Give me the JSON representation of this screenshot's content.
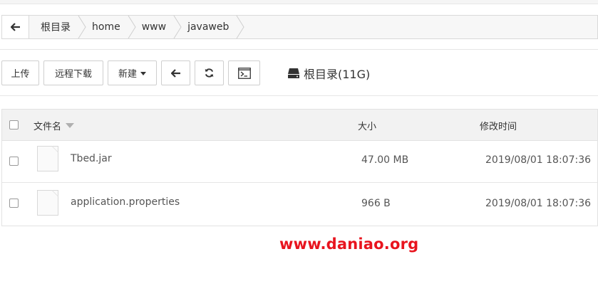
{
  "breadcrumb": {
    "items": [
      "根目录",
      "home",
      "www",
      "javaweb"
    ]
  },
  "toolbar": {
    "upload": "上传",
    "remote_download": "远程下载",
    "new": "新建",
    "disk_label": "根目录(11G)"
  },
  "table": {
    "headers": {
      "name": "文件名",
      "size": "大小",
      "modified": "修改时间"
    },
    "rows": [
      {
        "name": "Tbed.jar",
        "size": "47.00 MB",
        "modified": "2019/08/01 18:07:36"
      },
      {
        "name": "application.properties",
        "size": "966 B",
        "modified": "2019/08/01 18:07:36"
      }
    ]
  },
  "watermark": "www.daniao.org",
  "colors": {
    "watermark": "#e8141e",
    "header_bg": "#f2f2f2",
    "border": "#d9d9d9"
  },
  "icons": [
    "back-arrow-icon",
    "breadcrumb-separator-icon",
    "refresh-icon",
    "terminal-icon",
    "hard-drive-icon",
    "sort-caret-icon",
    "file-icon"
  ]
}
